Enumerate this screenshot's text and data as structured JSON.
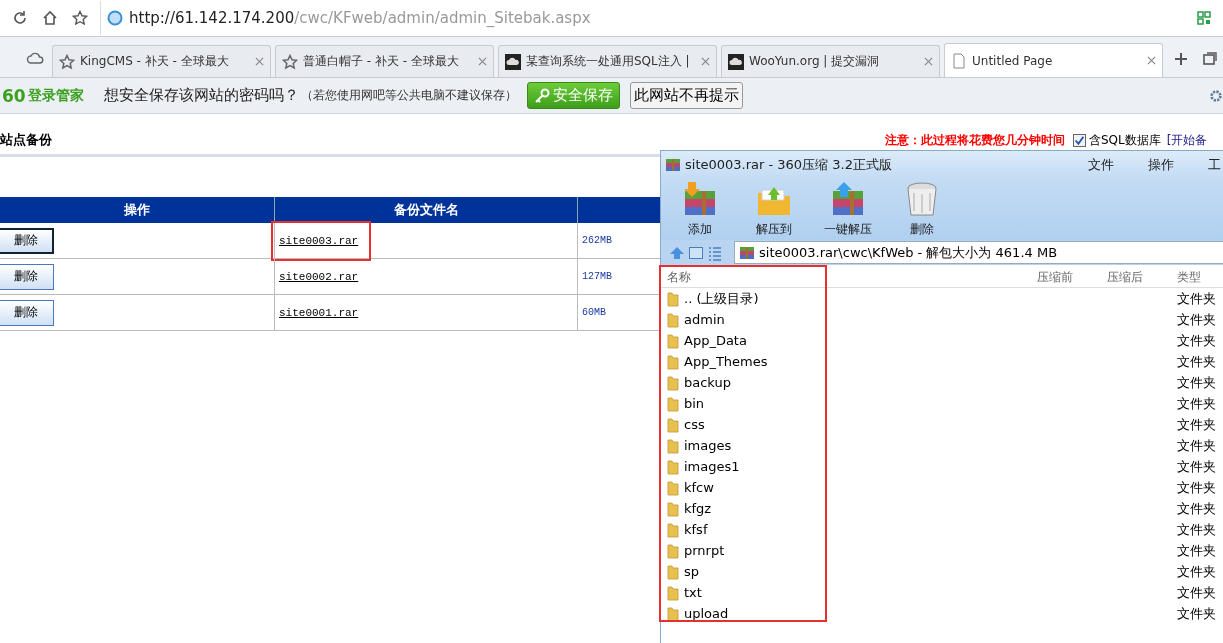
{
  "address_bar": {
    "url_host": "http://61.142.174.200",
    "url_path": "/cwc/KFweb/admin/admin_Sitebak.aspx"
  },
  "tabs": [
    {
      "title": "KingCMS - 补天 - 全球最大",
      "selected": false,
      "kind": "star"
    },
    {
      "title": "普通白帽子 - 补天 - 全球最大",
      "selected": false,
      "kind": "star"
    },
    {
      "title": "某查询系统一处通用SQL注入 |",
      "selected": false,
      "kind": "cloud"
    },
    {
      "title": "WooYun.org | 提交漏洞",
      "selected": false,
      "kind": "cloud"
    },
    {
      "title": "Untitled Page",
      "selected": true,
      "kind": "page"
    }
  ],
  "password_bar": {
    "logo": "60",
    "brand": "登录管家",
    "question": "想安全保存该网站的密码吗？",
    "hint": "（若您使用网吧等公共电脑不建议保存）",
    "save_button": "安全保存",
    "never_button": "此网站不再提示"
  },
  "page": {
    "title": "站点备份",
    "warning": "注意：此过程将花费您几分钟时间",
    "include_sql": {
      "label": "含SQL数据库",
      "checked": true
    },
    "start_link": "[开始备",
    "table": {
      "columns": [
        "操作",
        "备份文件名"
      ],
      "rows": [
        {
          "action": "删除",
          "file": "site0003.rar",
          "size": "262MB",
          "highlighted": true,
          "focused": true
        },
        {
          "action": "删除",
          "file": "site0002.rar",
          "size": "127MB",
          "highlighted": false,
          "focused": false
        },
        {
          "action": "删除",
          "file": "site0001.rar",
          "size": "60MB",
          "highlighted": false,
          "focused": false
        }
      ]
    }
  },
  "archive_window": {
    "title": "site0003.rar - 360压缩 3.2正式版",
    "menu": [
      "文件",
      "操作",
      "工"
    ],
    "toolbar": [
      {
        "label": "添加",
        "kind": "add"
      },
      {
        "label": "解压到",
        "kind": "extract"
      },
      {
        "label": "一键解压",
        "kind": "oneclick"
      },
      {
        "label": "删除",
        "kind": "delete"
      }
    ],
    "path": "site0003.rar\\cwc\\KfWeb - 解包大小为 461.4 MB",
    "columns": [
      "名称",
      "压缩前",
      "压缩后",
      "类型"
    ],
    "files": [
      {
        "name": ".. (上级目录)",
        "type": "文件夹"
      },
      {
        "name": "admin",
        "type": "文件夹"
      },
      {
        "name": "App_Data",
        "type": "文件夹"
      },
      {
        "name": "App_Themes",
        "type": "文件夹"
      },
      {
        "name": "backup",
        "type": "文件夹"
      },
      {
        "name": "bin",
        "type": "文件夹"
      },
      {
        "name": "css",
        "type": "文件夹"
      },
      {
        "name": "images",
        "type": "文件夹"
      },
      {
        "name": "images1",
        "type": "文件夹"
      },
      {
        "name": "kfcw",
        "type": "文件夹"
      },
      {
        "name": "kfgz",
        "type": "文件夹"
      },
      {
        "name": "kfsf",
        "type": "文件夹"
      },
      {
        "name": "prnrpt",
        "type": "文件夹"
      },
      {
        "name": "sp",
        "type": "文件夹"
      },
      {
        "name": "txt",
        "type": "文件夹"
      },
      {
        "name": "upload",
        "type": "文件夹"
      }
    ],
    "folders_highlighted": true
  }
}
